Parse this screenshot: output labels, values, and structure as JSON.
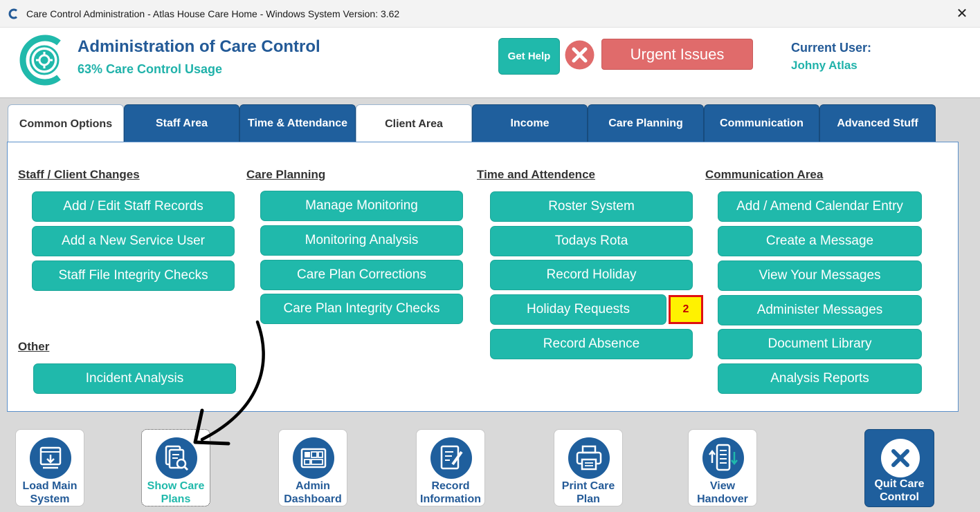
{
  "window": {
    "title": "Care Control Administration - Atlas House Care Home - Windows System Version: 3.62",
    "close_glyph": "✕"
  },
  "header": {
    "title": "Administration of Care Control",
    "usage": "63% Care Control Usage",
    "help_label": "Get Help",
    "urgent_label": "Urgent Issues",
    "current_user_label": "Current User:",
    "current_user_name": "Johny Atlas"
  },
  "colors": {
    "brand_blue": "#235a97",
    "tab_blue": "#1f5f9d",
    "teal": "#20b9ab",
    "urgent_red": "#e06b6b",
    "badge_yellow": "#fff200"
  },
  "tabs": [
    {
      "label": "Common Options",
      "active": true
    },
    {
      "label": "Staff Area",
      "active": false
    },
    {
      "label": "Time & Attendance",
      "active": false
    },
    {
      "label": "Client Area",
      "active": false
    },
    {
      "label": "Income",
      "active": false
    },
    {
      "label": "Care Planning",
      "active": false
    },
    {
      "label": "Communication",
      "active": false
    },
    {
      "label": "Advanced Stuff",
      "active": false
    }
  ],
  "sections": {
    "staff_client": {
      "heading": "Staff / Client Changes",
      "buttons": [
        "Add / Edit Staff Records",
        "Add a New Service User",
        "Staff File Integrity Checks"
      ]
    },
    "other": {
      "heading": "Other",
      "buttons": [
        "Incident Analysis"
      ]
    },
    "care_planning": {
      "heading": "Care Planning",
      "buttons": [
        "Manage Monitoring",
        "Monitoring Analysis",
        "Care Plan Corrections",
        "Care Plan Integrity Checks"
      ]
    },
    "time_attendance": {
      "heading": "Time and Attendence",
      "buttons": [
        "Roster System",
        "Todays Rota",
        "Record Holiday",
        "Holiday Requests",
        "Record Absence"
      ],
      "holiday_requests_badge": "2"
    },
    "communication": {
      "heading": "Communication Area",
      "buttons": [
        "Add / Amend Calendar Entry",
        "Create a Message",
        "View Your Messages",
        "Administer Messages",
        "Document Library",
        "Analysis Reports"
      ]
    }
  },
  "bottom_bar": [
    {
      "line1": "Load Main",
      "line2": "System",
      "icon": "load-system-icon"
    },
    {
      "line1": "Show Care",
      "line2": "Plans",
      "icon": "search-document-icon",
      "active": true
    },
    {
      "line1": "Admin",
      "line2": "Dashboard",
      "icon": "dashboard-icon"
    },
    {
      "line1": "Record",
      "line2": "Information",
      "icon": "edit-document-icon"
    },
    {
      "line1": "Print Care",
      "line2": "Plan",
      "icon": "printer-icon"
    },
    {
      "line1": "View",
      "line2": "Handover",
      "icon": "handover-icon"
    }
  ],
  "quit": {
    "line1": "Quit Care",
    "line2": "Control"
  }
}
